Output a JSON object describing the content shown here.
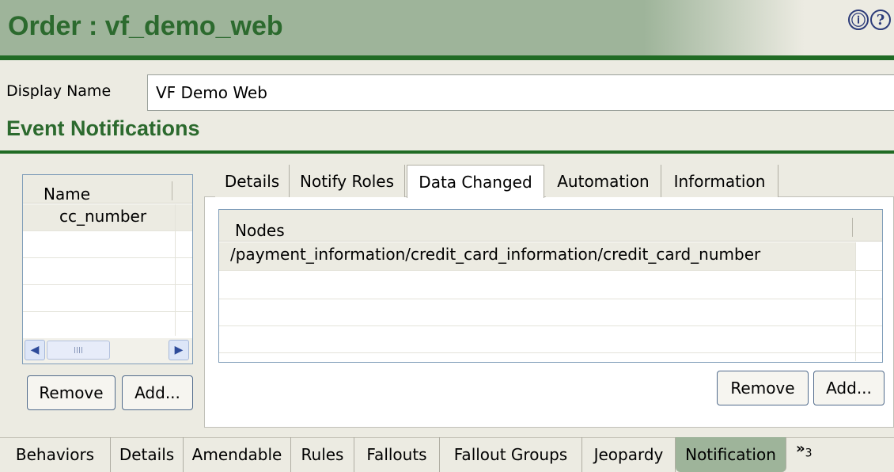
{
  "header": {
    "title": "Order : vf_demo_web",
    "info_icon": "ⓘ",
    "help_icon": "?"
  },
  "display_name": {
    "label": "Display Name",
    "value": "VF Demo Web"
  },
  "section": {
    "title": "Event Notifications"
  },
  "left_list": {
    "column_header": "Name",
    "items": [
      "cc_number"
    ],
    "remove_label": "Remove",
    "add_label": "Add..."
  },
  "right_panel": {
    "tabs": [
      "Details",
      "Notify Roles",
      "Data Changed",
      "Automation",
      "Information"
    ],
    "active_tab": "Data Changed",
    "table": {
      "column_header": "Nodes",
      "rows": [
        "/payment_information/credit_card_information/credit_card_number"
      ]
    },
    "remove_label": "Remove",
    "add_label": "Add..."
  },
  "bottom_tabs": {
    "items": [
      "Behaviors",
      "Details",
      "Amendable",
      "Rules",
      "Fallouts",
      "Fallout Groups",
      "Jeopardy",
      "Notification"
    ],
    "active": "Notification",
    "overflow_label": "»",
    "overflow_count": "3"
  },
  "colors": {
    "header_green": "#9eb49a",
    "title_green": "#2c6a2e",
    "rule_green": "#206b24",
    "panel_bg": "#ecebe2"
  }
}
